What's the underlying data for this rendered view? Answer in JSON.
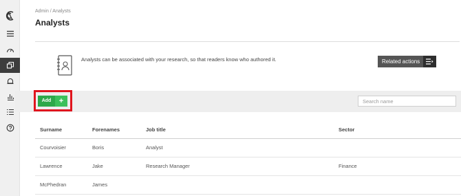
{
  "sidebar": {
    "icons": [
      "logo-icon",
      "menu-icon",
      "dashboard-icon",
      "analysts-icon",
      "bell-icon",
      "chart-icon",
      "list-icon",
      "help-icon"
    ],
    "active": "analysts-icon"
  },
  "breadcrumb": "Admin / Analysts",
  "page_title": "Analysts",
  "info": {
    "text": "Analysts can be associated with your research, so that readers know who authored it.",
    "icon": "address-book-icon"
  },
  "related_actions_label": "Related actions",
  "toolbar": {
    "add_label": "Add",
    "add_icon": "+",
    "search_placeholder": "Search name",
    "highlight_color": "#e0141d",
    "add_color": "#2da84a"
  },
  "table": {
    "headers": [
      "Surname",
      "Forenames",
      "Job title",
      "Sector"
    ],
    "rows": [
      [
        "Courvoisier",
        "Boris",
        "Analyst",
        ""
      ],
      [
        "Lawrence",
        "Jake",
        "Research Manager",
        "Finance"
      ],
      [
        "McPhedran",
        "James",
        "",
        ""
      ]
    ]
  }
}
